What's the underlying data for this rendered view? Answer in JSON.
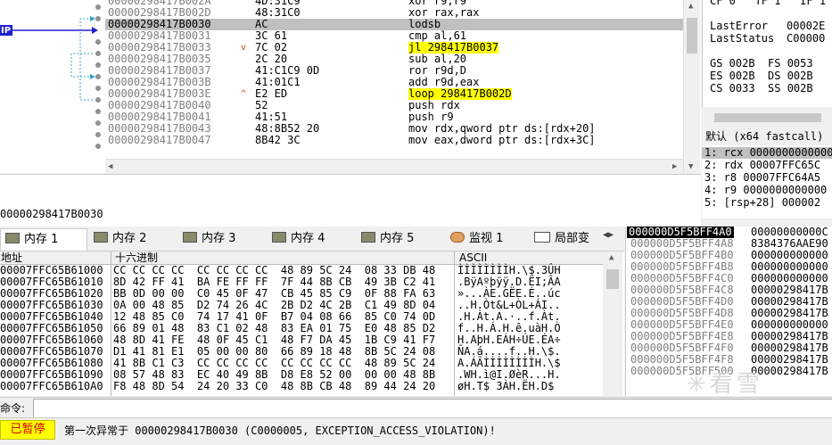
{
  "disasm": {
    "ip_label": "IP",
    "rows": [
      {
        "addr": "00000298417B002A",
        "bytes": "4D:31C9",
        "instr": "xor r9,r9",
        "mark": "",
        "hl": ""
      },
      {
        "addr": "00000298417B002D",
        "bytes": "48:31C0",
        "instr": "xor rax,rax",
        "mark": "",
        "hl": ""
      },
      {
        "addr": "00000298417B0030",
        "bytes": "AC",
        "instr": "lodsb",
        "mark": "",
        "hl": "",
        "current": true
      },
      {
        "addr": "00000298417B0031",
        "bytes": "3C 61",
        "instr": "cmp al,61",
        "mark": "",
        "hl": ""
      },
      {
        "addr": "00000298417B0033",
        "bytes": "7C 02",
        "instr": "jl 298417B0037",
        "mark": "v",
        "hl": "y"
      },
      {
        "addr": "00000298417B0035",
        "bytes": "2C 20",
        "instr": "sub al,20",
        "mark": "",
        "hl": ""
      },
      {
        "addr": "00000298417B0037",
        "bytes": "41:C1C9 0D",
        "instr": "ror r9d,D",
        "mark": "",
        "hl": ""
      },
      {
        "addr": "00000298417B003B",
        "bytes": "41:01C1",
        "instr": "add r9d,eax",
        "mark": "",
        "hl": ""
      },
      {
        "addr": "00000298417B003E",
        "bytes": "E2 ED",
        "instr": "loop 298417B002D",
        "mark": "^",
        "hl": "y"
      },
      {
        "addr": "00000298417B0040",
        "bytes": "52",
        "instr": "push rdx",
        "mark": "",
        "hl": ""
      },
      {
        "addr": "00000298417B0041",
        "bytes": "41:51",
        "instr": "push r9",
        "mark": "",
        "hl": ""
      },
      {
        "addr": "00000298417B0043",
        "bytes": "48:8B52 20",
        "instr": "mov rdx,qword ptr ds:[rdx+20]",
        "mark": "",
        "hl": ""
      },
      {
        "addr": "00000298417B0047",
        "bytes": "8B42 3C",
        "instr": "mov eax,dword ptr ds:[rdx+3C]",
        "mark": "",
        "hl": ""
      }
    ],
    "info_text": "00000298417B0030"
  },
  "registers": {
    "top_row": "CF 0   TF 1   IF 1",
    "last_error_label": "LastError",
    "last_error_value": "00002E",
    "last_status_label": "LastStatus",
    "last_status_value": "C00000",
    "seg_rows": [
      "GS 002B  FS 0053",
      "ES 002B  DS 002B",
      "CS 0033  SS 002B"
    ]
  },
  "callstack": {
    "convention": "默认 (x64 fastcall)",
    "args": [
      "1: rcx 0000000000000",
      "2: rdx 00007FFC65C",
      "3: r8 00007FFC64A5",
      "4: r9 0000000000000",
      "5: [rsp+28] 000002"
    ]
  },
  "tabs": [
    {
      "label": "内存 1",
      "icon": "memory-icon",
      "active": true
    },
    {
      "label": "内存 2",
      "icon": "memory-icon"
    },
    {
      "label": "内存 3",
      "icon": "memory-icon"
    },
    {
      "label": "内存 4",
      "icon": "memory-icon"
    },
    {
      "label": "内存 5",
      "icon": "memory-icon"
    },
    {
      "label": "监视 1",
      "icon": "watch-icon"
    },
    {
      "label": "局部变",
      "icon": "locals-icon",
      "prefix": "[x=]"
    }
  ],
  "dump": {
    "col_addr": "地址",
    "col_hex": "十六进制",
    "col_ascii": "ASCII",
    "rows": [
      {
        "addr": "00007FFC65B61000",
        "hex": "CC CC CC CC  CC CC CC CC  48 89 5C 24  08 33 DB 48",
        "ascii": "ÌÌÌÌÌÌÌÌH.\\$.3ÛH"
      },
      {
        "addr": "00007FFC65B61010",
        "hex": "8D 42 FF 41  BA FE FF FF  7F 44 8B CB  49 3B C2 41",
        "ascii": ".BÿAºþÿÿ.D.ËI;ÂA"
      },
      {
        "addr": "00007FFC65B61020",
        "hex": "BB 0D 00 00  C0 45 0F 47  CB 45 85 C9  0F 88 FA 63",
        "ascii": "»...ÀE.GËE.É..úc"
      },
      {
        "addr": "00007FFC65B61030",
        "hex": "0A 00 48 85  D2 74 26 4C  2B D2 4C 2B  C1 49 8D 04",
        "ascii": "..H.Òt&L+ÒL+ÁI.."
      },
      {
        "addr": "00007FFC65B61040",
        "hex": "12 48 85 C0  74 17 41 0F  B7 04 08 66  85 C0 74 0D",
        "ascii": ".H.Àt.A.·..f.Àt."
      },
      {
        "addr": "00007FFC65B61050",
        "hex": "66 89 01 48  83 C1 02 48  83 EA 01 75  E0 48 85 D2",
        "ascii": "f..H.Á.H.ê.uàH.Ò"
      },
      {
        "addr": "00007FFC65B61060",
        "hex": "48 8D 41 FE  48 0F 45 C1  48 F7 DA 45  1B C9 41 F7",
        "ascii": "H.AþH.EÁH÷ÚE.ÉA÷"
      },
      {
        "addr": "00007FFC65B61070",
        "hex": "D1 41 81 E1  05 00 00 80  66 89 18 48  8B 5C 24 08",
        "ascii": "ÑA.á....f..H.\\$."
      },
      {
        "addr": "00007FFC65B61080",
        "hex": "41 8B C1 C3  CC CC CC CC  CC CC CC CC  48 89 5C 24",
        "ascii": "A.ÁÃÌÌÌÌÌÌÌÌH.\\$"
      },
      {
        "addr": "00007FFC65B61090",
        "hex": "08 57 48 83  EC 40 49 8B  D8 E8 52 00  00 00 48 8B",
        "ascii": ".WH.ì@I.ØèR...H."
      },
      {
        "addr": "00007FFC65B610A0",
        "hex": "F8 48 8D 54  24 20 33 C0  48 8B CB 48  89 44 24 20",
        "ascii": "øH.T$ 3ÀH.ËH.D$ "
      }
    ]
  },
  "stack": {
    "rows": [
      {
        "addr": "000000D5F5BFF4A0",
        "val": "00000000000C"
      },
      {
        "addr": "000000D5F5BFF4A8",
        "val": "8384376AAE90"
      },
      {
        "addr": "000000D5F5BFF4B0",
        "val": "000000000000"
      },
      {
        "addr": "000000D5F5BFF4B8",
        "val": "000000000000"
      },
      {
        "addr": "000000D5F5BFF4C0",
        "val": "000000000000"
      },
      {
        "addr": "000000D5F5BFF4C8",
        "val": "00000298417B"
      },
      {
        "addr": "000000D5F5BFF4D0",
        "val": "00000298417B"
      },
      {
        "addr": "000000D5F5BFF4D8",
        "val": "00000298417B"
      },
      {
        "addr": "000000D5F5BFF4E0",
        "val": "000000000000"
      },
      {
        "addr": "000000D5F5BFF4E8",
        "val": "00000298417B"
      },
      {
        "addr": "000000D5F5BFF4F0",
        "val": "00000298417B"
      },
      {
        "addr": "000000D5F5BFF4F8",
        "val": "00000298417B"
      },
      {
        "addr": "000000D5F5BFF500",
        "val": "00000298417B"
      }
    ]
  },
  "command": {
    "label": "命令:",
    "value": ""
  },
  "status": {
    "paused": "已暂停",
    "message": "第一次异常于 00000298417B0030 (C0000005, EXCEPTION_ACCESS_VIOLATION)!"
  },
  "watermark": "看雪"
}
